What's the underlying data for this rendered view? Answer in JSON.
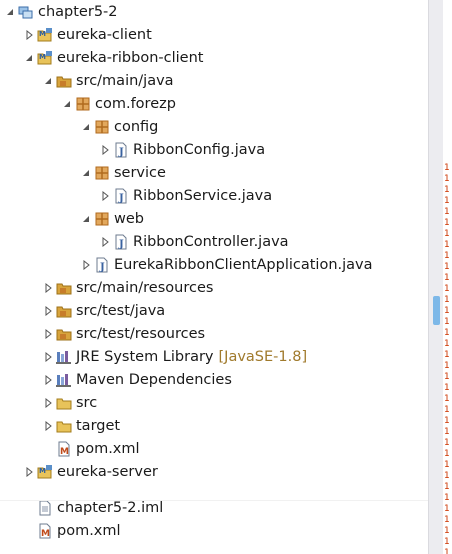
{
  "tree": [
    {
      "label": "chapter5-2",
      "depth": 0,
      "twisty": "open",
      "icon": "workingset-icon",
      "name": "chapter5-2"
    },
    {
      "label": "eureka-client",
      "depth": 1,
      "twisty": "closed",
      "icon": "maven-project-icon",
      "name": "eureka-client"
    },
    {
      "label": "eureka-ribbon-client",
      "depth": 1,
      "twisty": "open",
      "icon": "maven-project-icon",
      "name": "eureka-ribbon-client"
    },
    {
      "label": "src/main/java",
      "depth": 2,
      "twisty": "open",
      "icon": "source-folder-icon",
      "name": "src-main-java"
    },
    {
      "label": "com.forezp",
      "depth": 3,
      "twisty": "open",
      "icon": "package-icon",
      "name": "com-forezp"
    },
    {
      "label": "config",
      "depth": 4,
      "twisty": "open",
      "icon": "package-icon",
      "name": "config"
    },
    {
      "label": "RibbonConfig.java",
      "depth": 5,
      "twisty": "closed",
      "icon": "java-file-icon",
      "name": "ribbonconfig-java"
    },
    {
      "label": "service",
      "depth": 4,
      "twisty": "open",
      "icon": "package-icon",
      "name": "service"
    },
    {
      "label": "RibbonService.java",
      "depth": 5,
      "twisty": "closed",
      "icon": "java-file-icon",
      "name": "ribbonservice-java"
    },
    {
      "label": "web",
      "depth": 4,
      "twisty": "open",
      "icon": "package-icon",
      "name": "web"
    },
    {
      "label": "RibbonController.java",
      "depth": 5,
      "twisty": "closed",
      "icon": "java-file-icon",
      "name": "ribboncontroller-java"
    },
    {
      "label": "EurekaRibbonClientApplication.java",
      "depth": 4,
      "twisty": "closed",
      "icon": "java-file-icon",
      "name": "eurekaribbonclientapplication-java"
    },
    {
      "label": "src/main/resources",
      "depth": 2,
      "twisty": "closed",
      "icon": "source-folder-icon",
      "name": "src-main-resources"
    },
    {
      "label": "src/test/java",
      "depth": 2,
      "twisty": "closed",
      "icon": "source-folder-icon",
      "name": "src-test-java"
    },
    {
      "label": "src/test/resources",
      "depth": 2,
      "twisty": "closed",
      "icon": "source-folder-icon",
      "name": "src-test-resources"
    },
    {
      "label": "JRE System Library",
      "decoration": "[JavaSE-1.8]",
      "depth": 2,
      "twisty": "closed",
      "icon": "library-icon",
      "name": "jre-system-library"
    },
    {
      "label": "Maven Dependencies",
      "depth": 2,
      "twisty": "closed",
      "icon": "library-icon",
      "name": "maven-dependencies"
    },
    {
      "label": "src",
      "depth": 2,
      "twisty": "closed",
      "icon": "folder-icon",
      "name": "src"
    },
    {
      "label": "target",
      "depth": 2,
      "twisty": "closed",
      "icon": "folder-icon",
      "name": "target"
    },
    {
      "label": "pom.xml",
      "depth": 2,
      "twisty": "none",
      "icon": "maven-pom-icon",
      "name": "pom-xml"
    },
    {
      "label": "eureka-server",
      "depth": 1,
      "twisty": "closed",
      "icon": "maven-project-icon",
      "name": "eureka-server"
    },
    {
      "label": "chapter5-2.iml",
      "depth": 1,
      "twisty": "none",
      "icon": "text-file-icon",
      "name": "chapter5-2-iml",
      "gap": true
    },
    {
      "label": "pom.xml",
      "depth": 1,
      "twisty": "none",
      "icon": "maven-pom-icon",
      "name": "root-pom-xml"
    }
  ],
  "colors": {
    "twisty": "#555555",
    "package": "#b06a1e",
    "project": "#5a8fc9",
    "source_folder": "#d8a43c",
    "folder": "#e8c35a",
    "java_file": "#3a62a0",
    "library": "#7a5c9e",
    "decoration": "#a07a2c",
    "scroll_thumb": "#7db8e8",
    "error_marker": "#cc3300"
  }
}
